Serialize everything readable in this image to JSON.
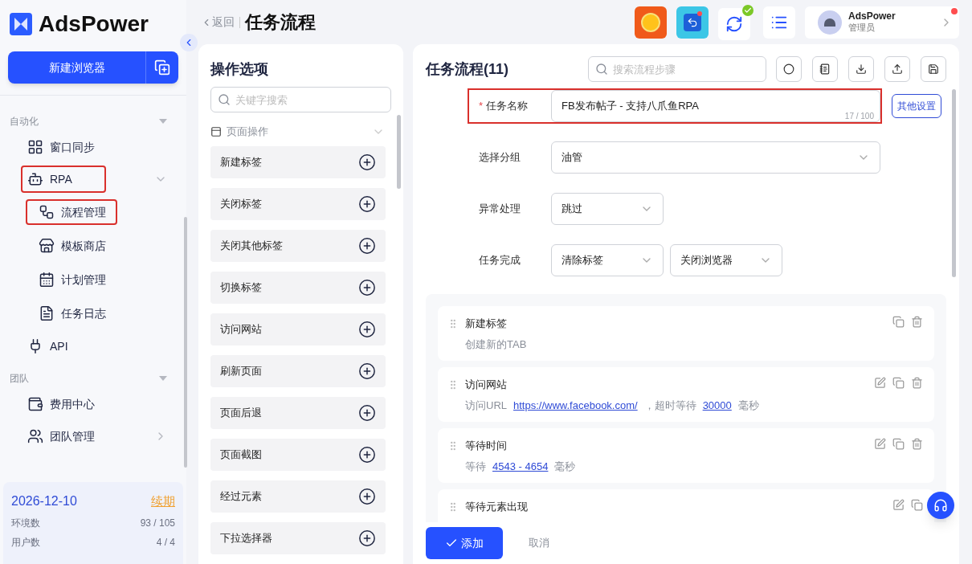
{
  "brand": {
    "name": "AdsPower"
  },
  "sidebar": {
    "new_browser_button": "新建浏览器",
    "sections": [
      {
        "title": "自动化",
        "items": [
          {
            "label": "窗口同步",
            "highlighted": false
          },
          {
            "label": "RPA",
            "highlighted": true,
            "expanded": true,
            "children": [
              {
                "label": "流程管理",
                "highlighted": true
              },
              {
                "label": "模板商店",
                "highlighted": false
              },
              {
                "label": "计划管理",
                "highlighted": false
              },
              {
                "label": "任务日志",
                "highlighted": false
              }
            ]
          },
          {
            "label": "API",
            "highlighted": false
          }
        ]
      },
      {
        "title": "团队",
        "items": [
          {
            "label": "费用中心",
            "highlighted": false
          },
          {
            "label": "团队管理",
            "highlighted": false,
            "has_submenu": true
          }
        ]
      }
    ],
    "plan": {
      "date": "2026-12-10",
      "renew": "续期",
      "stats": [
        {
          "label": "环境数",
          "value": "93 / 105"
        },
        {
          "label": "用户数",
          "value": "4 / 4"
        }
      ]
    }
  },
  "header": {
    "back": "返回",
    "title": "任务流程",
    "user": {
      "name": "AdsPower",
      "role": "管理员"
    }
  },
  "options_panel": {
    "title": "操作选项",
    "search_placeholder": "关键字搜索",
    "group": {
      "title": "页面操作",
      "expanded": true,
      "items": [
        "新建标签",
        "关闭标签",
        "关闭其他标签",
        "切换标签",
        "访问网站",
        "刷新页面",
        "页面后退",
        "页面截图",
        "经过元素",
        "下拉选择器"
      ]
    }
  },
  "flow_panel": {
    "title": "任务流程(11)",
    "search_placeholder": "搜索流程步骤",
    "other_settings": "其他设置",
    "form": [
      {
        "kind": "input",
        "label": "任务名称",
        "required_mark": "*",
        "highlighted": true,
        "value": "FB发布帖子 - 支持八爪鱼RPA",
        "counter": "17 / 100"
      },
      {
        "kind": "select",
        "label": "选择分组",
        "highlighted": false,
        "values": [
          "油管"
        ],
        "wide": true
      },
      {
        "kind": "select",
        "label": "异常处理",
        "highlighted": false,
        "values": [
          "跳过"
        ],
        "wide": false
      },
      {
        "kind": "select",
        "label": "任务完成",
        "highlighted": false,
        "values": [
          "清除标签",
          "关闭浏览器"
        ],
        "wide": false
      }
    ],
    "steps": [
      {
        "title": "新建标签",
        "editable": false,
        "deletable": true,
        "description": [
          {
            "text": "创建新的TAB",
            "link": false
          }
        ]
      },
      {
        "title": "访问网站",
        "editable": true,
        "deletable": true,
        "description": [
          {
            "text": "访问URL",
            "link": false
          },
          {
            "text": "https://www.facebook.com/",
            "link": true
          },
          {
            "text": "，超时等待",
            "link": false
          },
          {
            "text": "30000",
            "link": true
          },
          {
            "text": "毫秒",
            "link": false
          }
        ]
      },
      {
        "title": "等待时间",
        "editable": true,
        "deletable": true,
        "description": [
          {
            "text": "等待",
            "link": false
          },
          {
            "text": "4543 - 4654",
            "link": true
          },
          {
            "text": "毫秒",
            "link": false
          }
        ]
      },
      {
        "title": "等待元素出现",
        "editable": true,
        "deletable": false
      }
    ],
    "add_button": "添加",
    "cancel_button": "取消"
  }
}
